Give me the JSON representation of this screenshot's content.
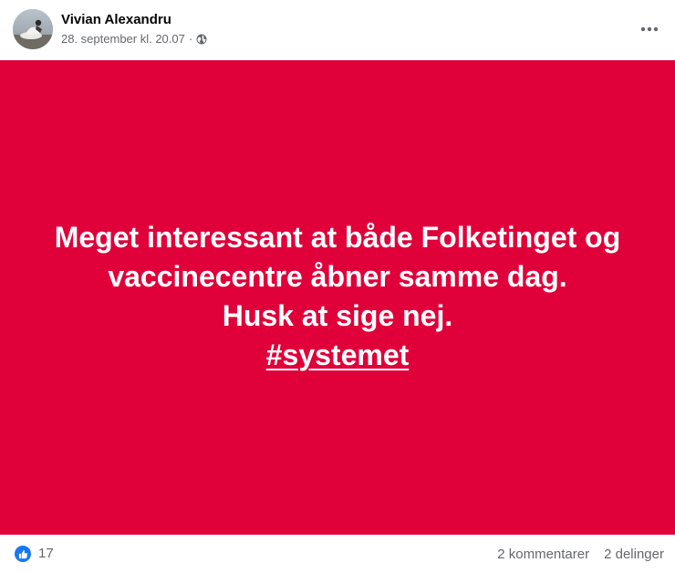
{
  "post": {
    "author": "Vivian Alexandru",
    "timestamp": "28. september kl. 20.07",
    "separator": "·",
    "privacy_icon": "globe-icon",
    "more_icon": "more-horizontal-icon"
  },
  "card": {
    "background_color": "#e0003a",
    "text_color": "#ffffff",
    "lines": [
      "Meget interessant at både Folketinget og",
      "vaccinecentre åbner samme dag.",
      "Husk at sige nej."
    ],
    "hashtag": "#systemet"
  },
  "footer": {
    "reaction_icon": "like-icon",
    "reaction_count": "17",
    "comments": "2 kommentarer",
    "shares": "2 delinger"
  },
  "colors": {
    "accent": "#1877f2",
    "secondary_text": "#65676b",
    "primary_text": "#050505"
  }
}
